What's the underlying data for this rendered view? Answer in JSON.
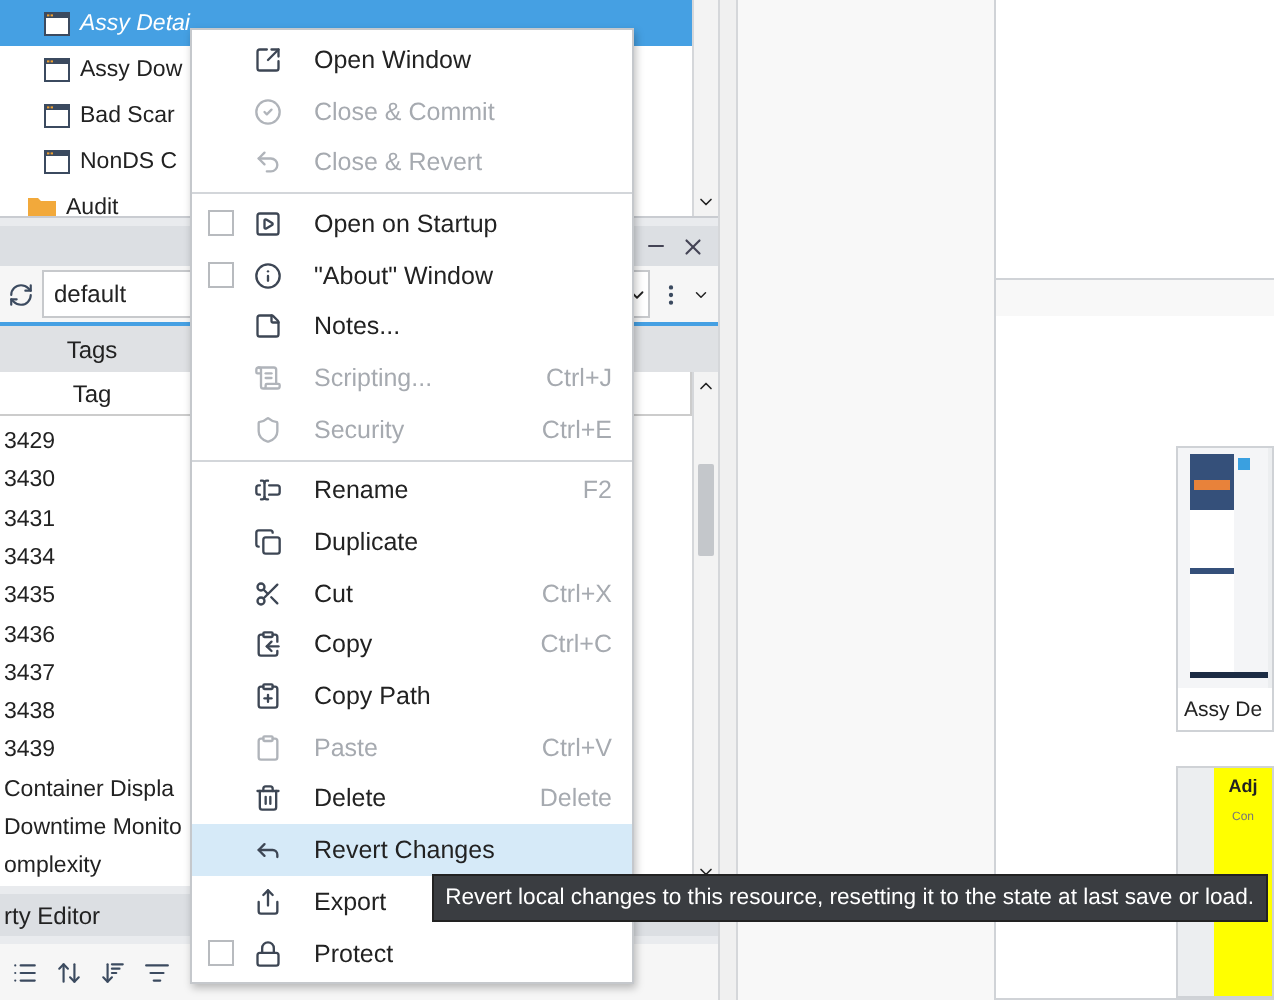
{
  "tree": [
    {
      "kind": "window",
      "label": "Assy Detai",
      "selected": true,
      "modified": true
    },
    {
      "kind": "window",
      "label": "Assy Dow",
      "selected": false,
      "modified": false
    },
    {
      "kind": "window",
      "label": "Bad Scar",
      "selected": false,
      "modified": false
    },
    {
      "kind": "window",
      "label": "NonDS C",
      "selected": false,
      "modified": false
    },
    {
      "kind": "folder",
      "label": "Audit",
      "selected": false,
      "modified": false
    }
  ],
  "tag_browser": {
    "provider": "default",
    "tab": "Tags",
    "column": "Tag",
    "rows": [
      "3429",
      "3430",
      "3431",
      "3434",
      "3435",
      "3436",
      "3437",
      "3438",
      "3439",
      "Container Displa",
      "Downtime Monito",
      "omplexity"
    ]
  },
  "property_editor": {
    "title": "rty Editor"
  },
  "thumbnails": [
    {
      "label": "Assy De",
      "kind": "picture"
    },
    {
      "kind": "yellow",
      "heading": "Adj",
      "note": "Con"
    }
  ],
  "context_menu": [
    {
      "kind": "item",
      "label": "Open Window",
      "disabled": false,
      "selected": false
    },
    {
      "kind": "item",
      "label": "Close & Commit",
      "disabled": true,
      "selected": false
    },
    {
      "kind": "item",
      "label": "Close & Revert",
      "disabled": true,
      "selected": false
    },
    {
      "kind": "separator"
    },
    {
      "kind": "check",
      "label": "Open on Startup",
      "disabled": false,
      "selected": false,
      "checked": false
    },
    {
      "kind": "check",
      "label": "\"About\" Window",
      "disabled": false,
      "selected": false,
      "checked": false
    },
    {
      "kind": "item",
      "label": "Notes...",
      "disabled": false,
      "selected": false
    },
    {
      "kind": "item",
      "label": "Scripting...",
      "shortcut": "Ctrl+J",
      "disabled": true,
      "selected": false
    },
    {
      "kind": "item",
      "label": "Security",
      "shortcut": "Ctrl+E",
      "disabled": true,
      "selected": false
    },
    {
      "kind": "separator"
    },
    {
      "kind": "item",
      "label": "Rename",
      "shortcut": "F2",
      "disabled": false,
      "selected": false
    },
    {
      "kind": "item",
      "label": "Duplicate",
      "disabled": false,
      "selected": false
    },
    {
      "kind": "item",
      "label": "Cut",
      "shortcut": "Ctrl+X",
      "disabled": false,
      "selected": false
    },
    {
      "kind": "item",
      "label": "Copy",
      "shortcut": "Ctrl+C",
      "disabled": false,
      "selected": false
    },
    {
      "kind": "item",
      "label": "Copy Path",
      "disabled": false,
      "selected": false
    },
    {
      "kind": "item",
      "label": "Paste",
      "shortcut": "Ctrl+V",
      "disabled": true,
      "selected": false
    },
    {
      "kind": "item",
      "label": "Delete",
      "shortcut": "Delete",
      "disabled": false,
      "selected": false
    },
    {
      "kind": "item",
      "label": "Revert Changes",
      "disabled": false,
      "selected": true
    },
    {
      "kind": "item",
      "label": "Export",
      "disabled": false,
      "selected": false
    },
    {
      "kind": "check",
      "label": "Protect",
      "disabled": false,
      "selected": false,
      "checked": false
    }
  ],
  "tooltip": "Revert local changes to this resource, resetting it to the state at last save or load."
}
